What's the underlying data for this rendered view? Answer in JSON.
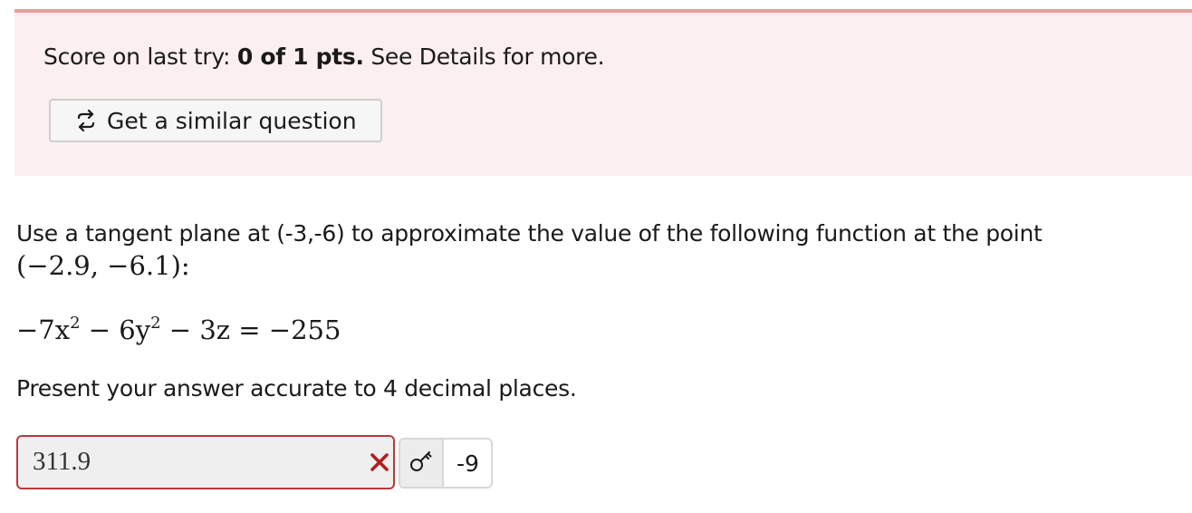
{
  "score": {
    "prefix": "Score on last try: ",
    "value": "0 of 1 pts.",
    "suffix": " See Details for more."
  },
  "similar_button": {
    "label": "Get a similar question",
    "icon": "retry-icon"
  },
  "question": {
    "text": "Use a tangent plane at (-3,-6) to approximate the value of the following function at the point",
    "point": "(−2.9, −6.1):",
    "equation_parts": {
      "t1": "−7x",
      "e1": "2",
      "t2": " − 6y",
      "e2": "2",
      "t3": " − 3z = −255"
    },
    "instruction": "Present your answer accurate to 4 decimal places."
  },
  "answer": {
    "value": "311.9",
    "status_icon": "wrong-x-icon",
    "status_color": "#b11f1f",
    "key_icon": "key-icon",
    "correct_value": "-9"
  },
  "colors": {
    "panel_background": "#fcefef",
    "panel_border": "#ec9a9a",
    "answer_border": "#b53a3a"
  }
}
